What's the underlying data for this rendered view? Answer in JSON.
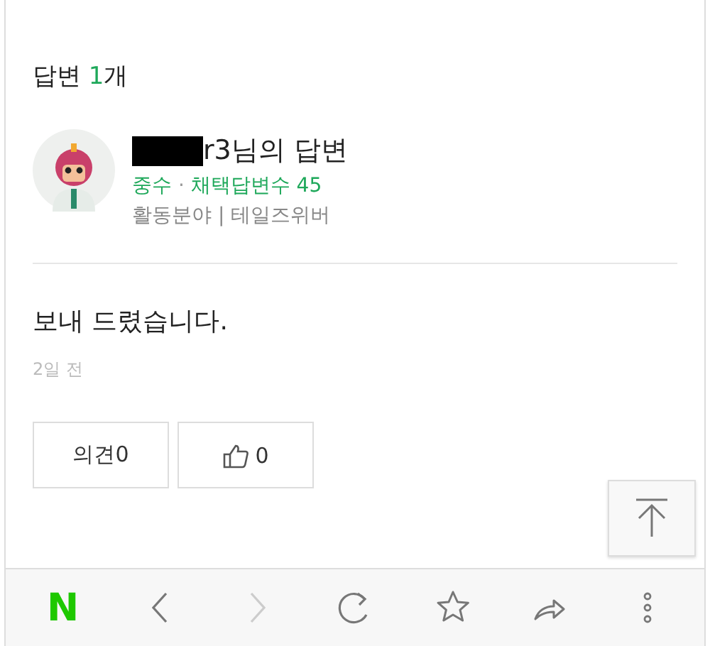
{
  "answers_header": {
    "label": "답변",
    "count": "1",
    "unit": "개"
  },
  "answer": {
    "author": {
      "redacted": true,
      "name": "r3님의 답변",
      "grade": "중수",
      "grade_separator": "·",
      "adopted_label": "채택답변수",
      "adopted_count": "45",
      "field_label": "활동분야",
      "field_separator": "|",
      "field_value": "테일즈위버"
    },
    "body": "보내 드렸습니다.",
    "time": "2일 전",
    "actions": [
      {
        "kind": "comment",
        "label": "의견0"
      },
      {
        "kind": "like",
        "label": "0"
      }
    ]
  },
  "scroll_top": {
    "kind": "top"
  },
  "toolbar": [
    {
      "kind": "logo",
      "text": "N",
      "disabled": false
    },
    {
      "kind": "back",
      "disabled": false
    },
    {
      "kind": "forward",
      "disabled": true
    },
    {
      "kind": "reload",
      "disabled": false
    },
    {
      "kind": "bookmark",
      "disabled": false
    },
    {
      "kind": "share",
      "disabled": false
    },
    {
      "kind": "more",
      "disabled": false
    }
  ]
}
